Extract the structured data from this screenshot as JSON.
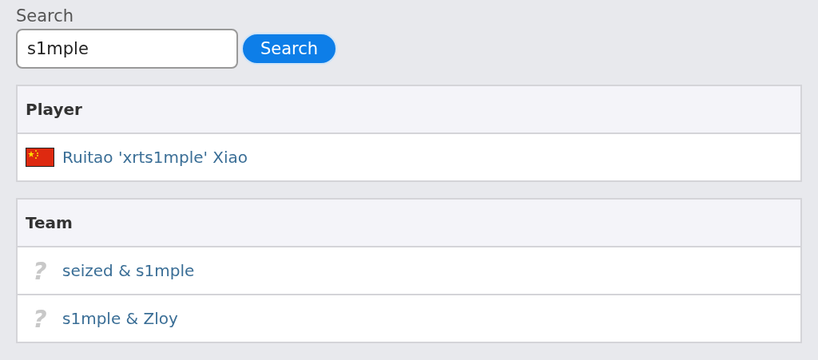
{
  "search": {
    "label": "Search",
    "value": "s1mple",
    "button": "Search"
  },
  "sections": [
    {
      "heading": "Player",
      "rows": [
        {
          "kind": "flag",
          "text": "Ruitao 'xrts1mple' Xiao"
        }
      ]
    },
    {
      "heading": "Team",
      "rows": [
        {
          "kind": "unknown",
          "icon_text": "?",
          "text": "seized & s1mple"
        },
        {
          "kind": "unknown",
          "icon_text": "?",
          "text": "s1mple & Zloy"
        }
      ]
    }
  ]
}
